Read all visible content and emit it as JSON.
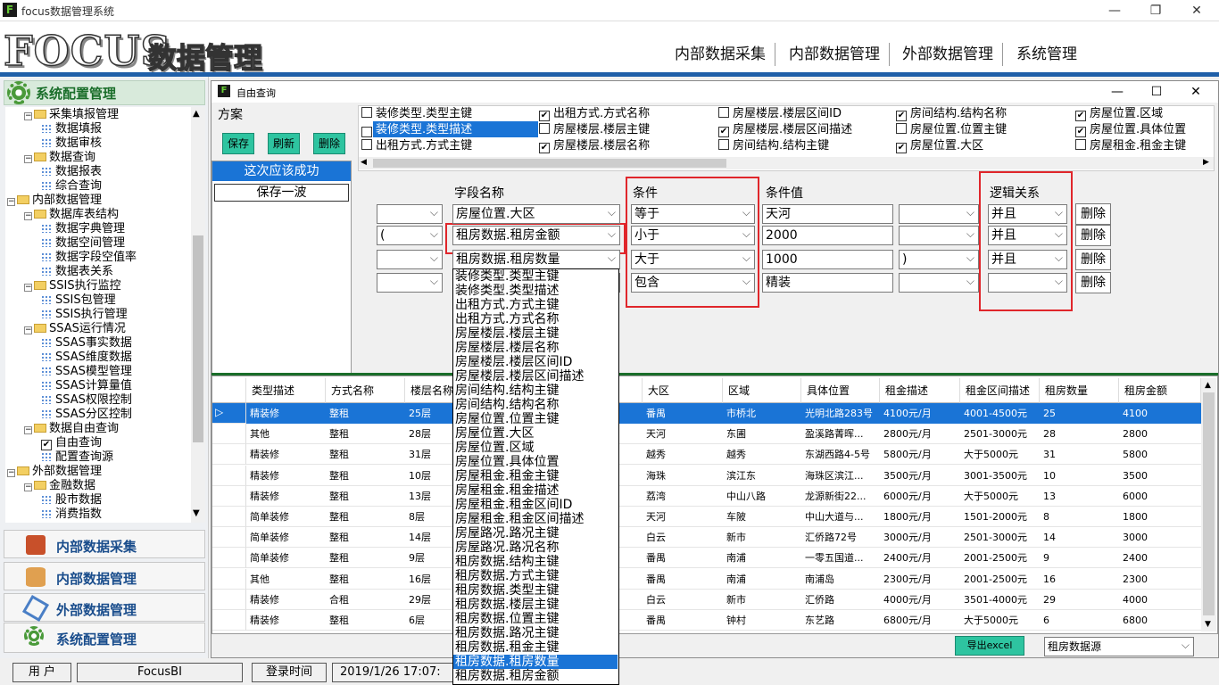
{
  "window": {
    "title": "focus数据管理系统",
    "minimize": "—",
    "maximize": "❐",
    "close": "✕"
  },
  "banner": {
    "logo": "FOCUS",
    "logo_sub": "数据管理"
  },
  "top_nav": [
    "内部数据采集",
    "内部数据管理",
    "外部数据管理",
    "系统管理"
  ],
  "sidebar": {
    "header": "系统配置管理",
    "tree": [
      {
        "label": "采集填报管理",
        "level": 1,
        "type": "folder",
        "exp": "−"
      },
      {
        "label": "数据填报",
        "level": 2,
        "type": "leaf"
      },
      {
        "label": "数据审核",
        "level": 2,
        "type": "leaf"
      },
      {
        "label": "数据查询",
        "level": 1,
        "type": "folder",
        "exp": "−"
      },
      {
        "label": "数据报表",
        "level": 2,
        "type": "leaf"
      },
      {
        "label": "综合查询",
        "level": 2,
        "type": "leaf"
      },
      {
        "label": "内部数据管理",
        "level": 0,
        "type": "folder",
        "exp": "−"
      },
      {
        "label": "数据库表结构",
        "level": 1,
        "type": "folder",
        "exp": "−"
      },
      {
        "label": "数据字典管理",
        "level": 2,
        "type": "leaf"
      },
      {
        "label": "数据空间管理",
        "level": 2,
        "type": "leaf"
      },
      {
        "label": "数据字段空值率",
        "level": 2,
        "type": "leaf"
      },
      {
        "label": "数据表关系",
        "level": 2,
        "type": "leaf"
      },
      {
        "label": "SSIS执行监控",
        "level": 1,
        "type": "folder",
        "exp": "−"
      },
      {
        "label": "SSIS包管理",
        "level": 2,
        "type": "leaf"
      },
      {
        "label": "SSIS执行管理",
        "level": 2,
        "type": "leaf"
      },
      {
        "label": "SSAS运行情况",
        "level": 1,
        "type": "folder",
        "exp": "−"
      },
      {
        "label": "SSAS事实数据",
        "level": 2,
        "type": "leaf"
      },
      {
        "label": "SSAS维度数据",
        "level": 2,
        "type": "leaf"
      },
      {
        "label": "SSAS模型管理",
        "level": 2,
        "type": "leaf"
      },
      {
        "label": "SSAS计算量值",
        "level": 2,
        "type": "leaf"
      },
      {
        "label": "SSAS权限控制",
        "level": 2,
        "type": "leaf"
      },
      {
        "label": "SSAS分区控制",
        "level": 2,
        "type": "leaf"
      },
      {
        "label": "数据自由查询",
        "level": 1,
        "type": "folder",
        "exp": "−"
      },
      {
        "label": "自由查询",
        "level": 2,
        "type": "checked"
      },
      {
        "label": "配置查询源",
        "level": 2,
        "type": "leaf"
      },
      {
        "label": "外部数据管理",
        "level": 0,
        "type": "folder",
        "exp": "−"
      },
      {
        "label": "金融数据",
        "level": 1,
        "type": "folder",
        "exp": "−"
      },
      {
        "label": "股市数据",
        "level": 2,
        "type": "leaf"
      },
      {
        "label": "消费指数",
        "level": 2,
        "type": "leaf"
      }
    ],
    "nav_buttons": [
      "内部数据采集",
      "内部数据管理",
      "外部数据管理",
      "系统配置管理"
    ]
  },
  "dialog": {
    "title": "自由查询",
    "plan": {
      "title": "方案",
      "save": "保存",
      "refresh": "刷新",
      "delete": "删除",
      "items": [
        "这次应该成功",
        "保存一波"
      ]
    },
    "fields": [
      {
        "label": "装修类型.类型主键",
        "checked": false
      },
      {
        "label": "装修类型.类型描述",
        "checked": true
      },
      {
        "label": "出租方式.方式主键",
        "checked": false
      },
      {
        "label": "出租方式.方式名称",
        "checked": true
      },
      {
        "label": "房屋楼层.楼层主键",
        "checked": false
      },
      {
        "label": "房屋楼层.楼层名称",
        "checked": true
      },
      {
        "label": "房屋楼层.楼层区间ID",
        "checked": false
      },
      {
        "label": "房屋楼层.楼层区间描述",
        "checked": true
      },
      {
        "label": "房间结构.结构主键",
        "checked": false
      },
      {
        "label": "房间结构.结构名称",
        "checked": true
      },
      {
        "label": "房屋位置.位置主键",
        "checked": false
      },
      {
        "label": "房屋位置.大区",
        "checked": true
      },
      {
        "label": "房屋位置.区域",
        "checked": true
      },
      {
        "label": "房屋位置.具体位置",
        "checked": true
      },
      {
        "label": "房屋租金.租金主键",
        "checked": false
      }
    ],
    "query_headers": {
      "field": "字段名称",
      "condition": "条件",
      "value": "条件值",
      "logic": "逻辑关系"
    },
    "query_rows": [
      {
        "lparen": "",
        "field": "房屋位置.大区",
        "cond": "等于",
        "value": "天河",
        "rparen": "",
        "logic": "并且",
        "del": "删除"
      },
      {
        "lparen": "(",
        "field": "租房数据.租房金额",
        "cond": "小于",
        "value": "2000",
        "rparen": "",
        "logic": "并且",
        "del": "删除"
      },
      {
        "lparen": "",
        "field": "租房数据.租房数量",
        "cond": "大于",
        "value": "1000",
        "rparen": ")",
        "logic": "并且",
        "del": "删除"
      },
      {
        "lparen": "",
        "field": "",
        "cond": "包含",
        "value": "精装",
        "rparen": "",
        "logic": "",
        "del": "删除"
      }
    ],
    "dropdown_options": [
      "装修类型.类型主键",
      "装修类型.类型描述",
      "出租方式.方式主键",
      "出租方式.方式名称",
      "房屋楼层.楼层主键",
      "房屋楼层.楼层名称",
      "房屋楼层.楼层区间ID",
      "房屋楼层.楼层区间描述",
      "房间结构.结构主键",
      "房间结构.结构名称",
      "房屋位置.位置主键",
      "房屋位置.大区",
      "房屋位置.区域",
      "房屋位置.具体位置",
      "房屋租金.租金主键",
      "房屋租金.租金描述",
      "房屋租金.租金区间ID",
      "房屋租金.租金区间描述",
      "房屋路况.路况主键",
      "房屋路况.路况名称",
      "租房数据.结构主键",
      "租房数据.方式主键",
      "租房数据.类型主键",
      "租房数据.楼层主键",
      "租房数据.位置主键",
      "租房数据.路况主键",
      "租房数据.租金主键",
      "租房数据.租房数量",
      "租房数据.租房金额"
    ],
    "dropdown_selected": 27,
    "grid": {
      "columns": [
        "类型描述",
        "方式名称",
        "楼层名称",
        "",
        "大区",
        "区域",
        "具体位置",
        "租金描述",
        "租金区间描述",
        "租房数量",
        "租房金额"
      ],
      "rows": [
        [
          "精装修",
          "整租",
          "25层",
          "",
          "番禺",
          "市桥北",
          "光明北路283号",
          "4100元/月",
          "4001-4500元",
          "25",
          "4100"
        ],
        [
          "其他",
          "整租",
          "28层",
          "",
          "天河",
          "东圃",
          "盈溪路菁晖...",
          "2800元/月",
          "2501-3000元",
          "28",
          "2800"
        ],
        [
          "精装修",
          "整租",
          "31层",
          "",
          "越秀",
          "越秀",
          "东湖西路4-5号",
          "5800元/月",
          "大于5000元",
          "31",
          "5800"
        ],
        [
          "精装修",
          "整租",
          "10层",
          "",
          "海珠",
          "滨江东",
          "海珠区滨江...",
          "3500元/月",
          "3001-3500元",
          "10",
          "3500"
        ],
        [
          "精装修",
          "整租",
          "13层",
          "",
          "荔湾",
          "中山八路",
          "龙源新街22...",
          "6000元/月",
          "大于5000元",
          "13",
          "6000"
        ],
        [
          "简单装修",
          "整租",
          "8层",
          "",
          "天河",
          "车陂",
          "中山大道与...",
          "1800元/月",
          "1501-2000元",
          "8",
          "1800"
        ],
        [
          "简单装修",
          "整租",
          "14层",
          "",
          "白云",
          "新市",
          "汇侨路72号",
          "3000元/月",
          "2501-3000元",
          "14",
          "3000"
        ],
        [
          "简单装修",
          "整租",
          "9层",
          "",
          "番禺",
          "南浦",
          "一零五国道...",
          "2400元/月",
          "2001-2500元",
          "9",
          "2400"
        ],
        [
          "其他",
          "整租",
          "16层",
          "",
          "番禺",
          "南浦",
          "南浦岛",
          "2300元/月",
          "2001-2500元",
          "16",
          "2300"
        ],
        [
          "精装修",
          "合租",
          "29层",
          "",
          "白云",
          "新市",
          "汇侨路",
          "4000元/月",
          "3501-4000元",
          "29",
          "4000"
        ],
        [
          "精装修",
          "整租",
          "6层",
          "",
          "番禺",
          "钟村",
          "东艺路",
          "6800元/月",
          "大于5000元",
          "6",
          "6800"
        ]
      ]
    },
    "export_label": "导出excel",
    "source_select": "租房数据源"
  },
  "status": {
    "user_label": "用 户",
    "user": "FocusBI",
    "login_label": "登录时间",
    "login_time": "2019/1/26 17:07:"
  }
}
